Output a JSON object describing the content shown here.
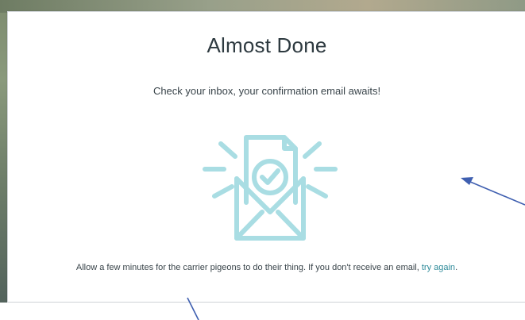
{
  "card": {
    "title": "Almost Done",
    "subtitle": "Check your inbox, your confirmation email awaits!",
    "message_text": "Allow a few minutes for the carrier pigeons to do their thing. If you don't receive an email, ",
    "retry_link": "try again",
    "message_end": "."
  },
  "icons": {
    "illustration": "envelope-with-checkmark-document-icon"
  },
  "colors": {
    "illustration": "#a9dde3",
    "link": "#2f8b9a",
    "annotation_arrow": "#3f5fb0"
  }
}
